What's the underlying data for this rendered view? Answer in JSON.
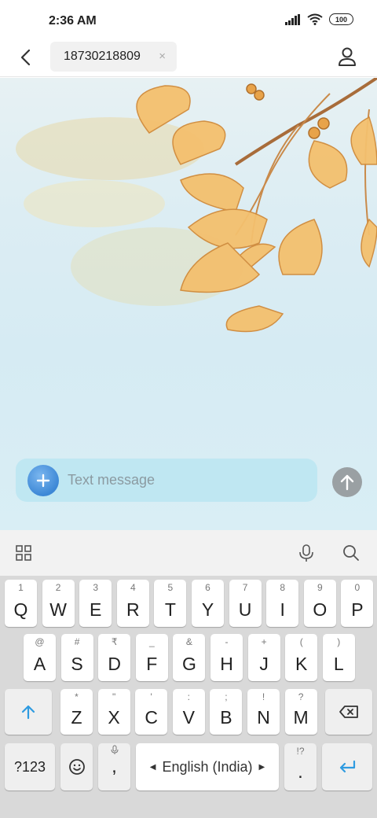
{
  "status_bar": {
    "time": "2:36 AM",
    "battery": "100"
  },
  "header": {
    "recipient": "18730218809",
    "remove_glyph": "×"
  },
  "composer": {
    "placeholder": "Text message"
  },
  "keyboard": {
    "row1": [
      {
        "hint": "1",
        "key": "Q"
      },
      {
        "hint": "2",
        "key": "W"
      },
      {
        "hint": "3",
        "key": "E"
      },
      {
        "hint": "4",
        "key": "R"
      },
      {
        "hint": "5",
        "key": "T"
      },
      {
        "hint": "6",
        "key": "Y"
      },
      {
        "hint": "7",
        "key": "U"
      },
      {
        "hint": "8",
        "key": "I"
      },
      {
        "hint": "9",
        "key": "O"
      },
      {
        "hint": "0",
        "key": "P"
      }
    ],
    "row2": [
      {
        "hint": "@",
        "key": "A"
      },
      {
        "hint": "#",
        "key": "S"
      },
      {
        "hint": "₹",
        "key": "D"
      },
      {
        "hint": "_",
        "key": "F"
      },
      {
        "hint": "&",
        "key": "G"
      },
      {
        "hint": "-",
        "key": "H"
      },
      {
        "hint": "+",
        "key": "J"
      },
      {
        "hint": "(",
        "key": "K"
      },
      {
        "hint": ")",
        "key": "L"
      }
    ],
    "row3": [
      {
        "hint": "*",
        "key": "Z"
      },
      {
        "hint": "\"",
        "key": "X"
      },
      {
        "hint": "'",
        "key": "C"
      },
      {
        "hint": ":",
        "key": "V"
      },
      {
        "hint": ";",
        "key": "B"
      },
      {
        "hint": "!",
        "key": "N"
      },
      {
        "hint": "?",
        "key": "M"
      }
    ],
    "symbols_label": "?123",
    "comma_label": ",",
    "space_label": "English (India)",
    "period_hint": "!?",
    "period_label": "."
  },
  "icons": {
    "back": "back-arrow-icon",
    "contact": "person-icon",
    "attach": "plus-icon",
    "send": "arrow-up-icon",
    "grid": "grid-icon",
    "mic": "microphone-icon",
    "search": "search-icon"
  },
  "colors": {
    "composer_bg": "#bfe7f2",
    "accent_blue": "#3d88d6",
    "send_disabled": "#9aa0a3",
    "enter_blue": "#2f9be0"
  }
}
